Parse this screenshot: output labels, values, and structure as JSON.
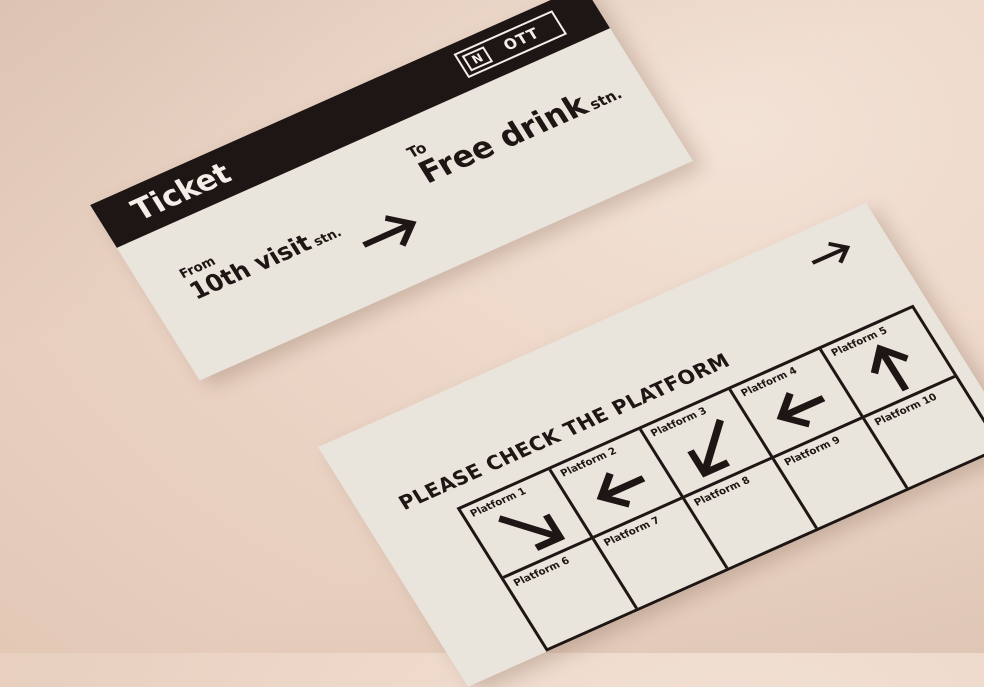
{
  "ticket": {
    "title": "Ticket",
    "logo_mark": "N",
    "logo_text": "OTT",
    "from_label": "From",
    "from_value": "10th visit",
    "from_suffix": "stn.",
    "to_label": "To",
    "to_value": "Free drink",
    "to_suffix": "stn."
  },
  "stamp_card": {
    "heading": "PLEASE CHECK THE PLATFORM",
    "platforms": [
      {
        "label": "Platform 1",
        "arrow": "arrow-down-right-icon"
      },
      {
        "label": "Platform 2",
        "arrow": "arrow-left-icon"
      },
      {
        "label": "Platform 3",
        "arrow": "arrow-down-left-icon"
      },
      {
        "label": "Platform 4",
        "arrow": "arrow-left-icon"
      },
      {
        "label": "Platform 5",
        "arrow": "arrow-up-icon"
      },
      {
        "label": "Platform 6",
        "arrow": ""
      },
      {
        "label": "Platform 7",
        "arrow": ""
      },
      {
        "label": "Platform 8",
        "arrow": ""
      },
      {
        "label": "Platform 9",
        "arrow": ""
      },
      {
        "label": "Platform 10",
        "arrow": ""
      }
    ]
  },
  "colors": {
    "ink": "#1e1614",
    "paper": "#e9e4dc",
    "background": "#ecd6c7"
  }
}
